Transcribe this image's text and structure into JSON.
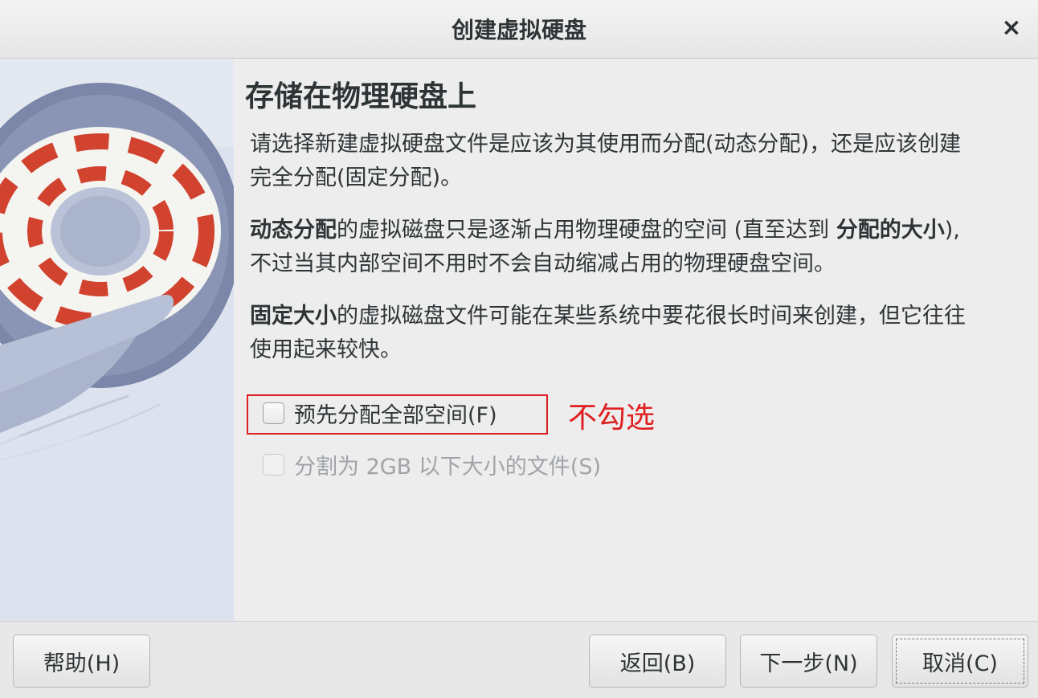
{
  "window": {
    "title": "创建虚拟硬盘",
    "close_icon": "×"
  },
  "main": {
    "heading": "存储在物理硬盘上",
    "paragraph1": "请选择新建虚拟硬盘文件是应该为其使用而分配(动态分配)，还是应该创建完全分配(固定分配)。",
    "paragraph2": {
      "bold_start": "动态分配",
      "middle": "的虚拟磁盘只是逐渐占用物理硬盘的空间 (直至达到 ",
      "bold_mid": "分配的大小",
      "end": "), 不过当其内部空间不用时不会自动缩减占用的物理硬盘空间。"
    },
    "paragraph3": {
      "bold_start": "固定大小",
      "end": "的虚拟磁盘文件可能在某些系统中要花很长时间来创建，但它往往使用起来较快。"
    },
    "options": {
      "preallocate_label": "预先分配全部空间(F)",
      "preallocate_checked": false,
      "split_label": "分割为 2GB 以下大小的文件(S)",
      "split_checked": false,
      "split_enabled": false
    },
    "annotation": "不勾选"
  },
  "buttons": {
    "help": "帮助(H)",
    "back": "返回(B)",
    "next": "下一步(N)",
    "cancel": "取消(C)"
  },
  "colors": {
    "annotation_red": "#e02020",
    "art_background": "#dde3ee",
    "art_disc": "#7b86a8",
    "art_dashes": "#d1432f"
  }
}
